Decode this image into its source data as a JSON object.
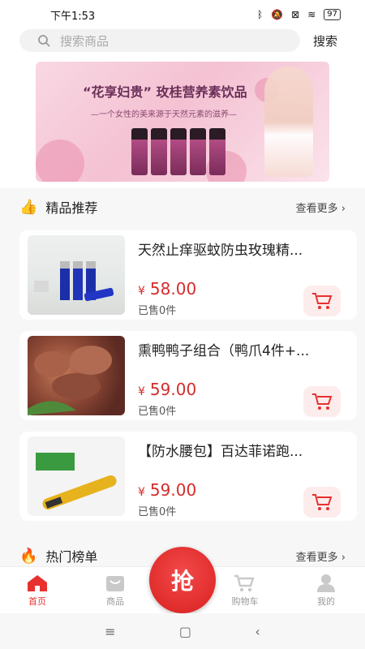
{
  "status": {
    "time": "下午1:53",
    "battery": "97"
  },
  "search": {
    "placeholder": "搜索商品",
    "button": "搜索"
  },
  "banner": {
    "title": "“花享妇贵”  玫桂营养素饮品",
    "subtitle": "—一个女性的美来源于天然元素的滋养—"
  },
  "featured": {
    "title": "精品推荐",
    "more": "查看更多"
  },
  "products": [
    {
      "name": "天然止痒驱蚊防虫玫瑰精...",
      "currency": "¥",
      "price": "58.00",
      "sold": "已售0件"
    },
    {
      "name": "熏鸭鸭子组合（鸭爪4件+...",
      "currency": "¥",
      "price": "59.00",
      "sold": "已售0件"
    },
    {
      "name": "【防水腰包】百达菲诺跑...",
      "currency": "¥",
      "price": "59.00",
      "sold": "已售0件"
    }
  ],
  "hot": {
    "title": "热门榜单",
    "more": "查看更多"
  },
  "tabs": {
    "home": "首页",
    "goods": "商品",
    "grab": "抢",
    "cart": "购物车",
    "mine": "我的"
  },
  "colors": {
    "accent": "#e8312f",
    "price": "#d62c2c"
  }
}
